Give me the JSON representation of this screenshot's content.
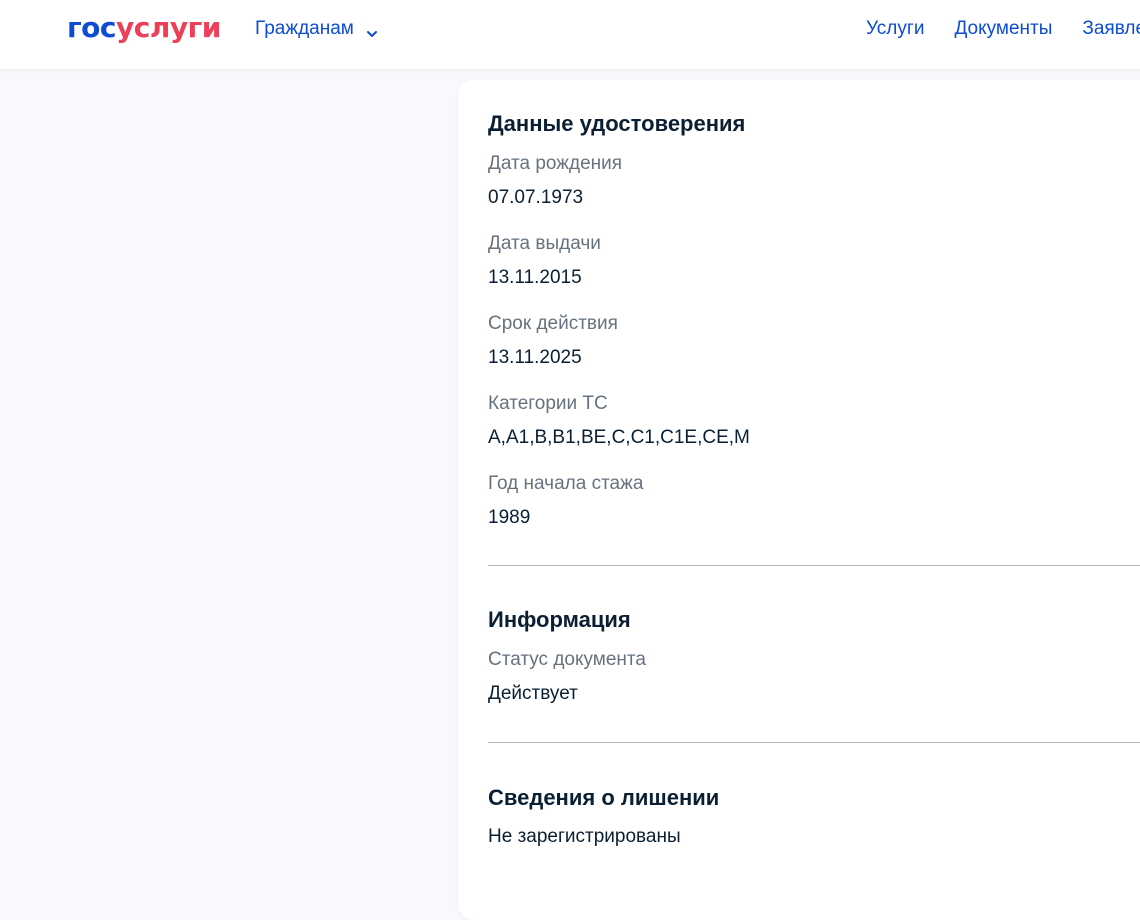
{
  "header": {
    "logo_part1": "гос",
    "logo_part2": "услуги",
    "citizens_label": "Гражданам",
    "nav": [
      {
        "label": "Услуги"
      },
      {
        "label": "Документы"
      },
      {
        "label": "Заявления"
      }
    ],
    "icons": {
      "citizens_dropdown": "chevron-down-icon"
    }
  },
  "license": {
    "title": "Данные удостоверения",
    "fields": [
      {
        "label": "Дата рождения",
        "value": "07.07.1973"
      },
      {
        "label": "Дата выдачи",
        "value": "13.11.2015"
      },
      {
        "label": "Срок действия",
        "value": "13.11.2025"
      },
      {
        "label": "Категории ТС",
        "value": "A,A1,B,B1,BE,C,C1,C1E,CE,M"
      },
      {
        "label": "Год начала стажа",
        "value": "1989"
      }
    ]
  },
  "info": {
    "title": "Информация",
    "status_label": "Статус документа",
    "status_value": "Действует"
  },
  "deprivation": {
    "title": "Сведения о лишении",
    "value": "Не зарегистрированы"
  },
  "colors": {
    "brand_blue": "#0d4cd3",
    "brand_red": "#ee3f58",
    "text": "#0b1f33",
    "muted": "#66727f",
    "page_bg": "#f8f9fd"
  }
}
